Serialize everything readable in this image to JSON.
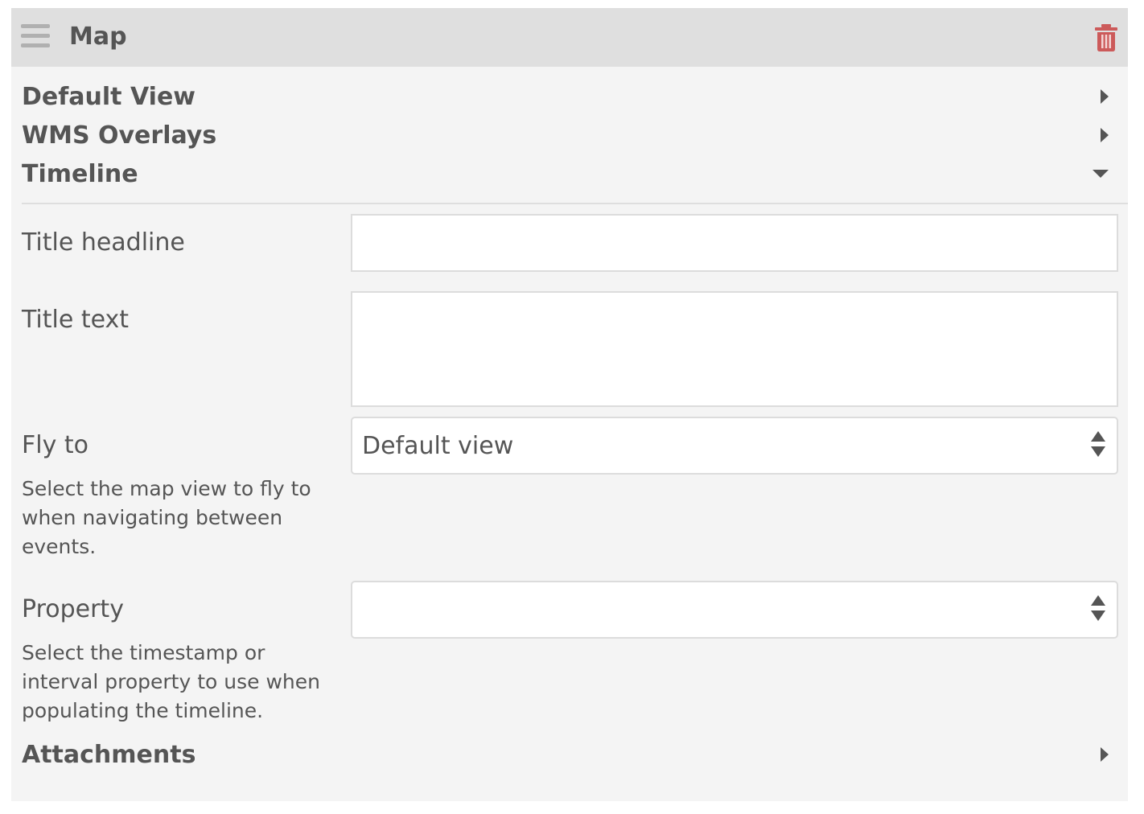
{
  "header": {
    "title": "Map",
    "menu_icon": "hamburger-icon",
    "delete_icon": "trash-icon",
    "delete_color": "#cc5a5a"
  },
  "sections": {
    "default_view": {
      "label": "Default View",
      "state": "collapsed"
    },
    "wms_overlays": {
      "label": "WMS Overlays",
      "state": "collapsed"
    },
    "timeline": {
      "label": "Timeline",
      "state": "expanded"
    },
    "attachments": {
      "label": "Attachments",
      "state": "collapsed"
    }
  },
  "timeline": {
    "title_headline": {
      "label": "Title headline",
      "value": ""
    },
    "title_text": {
      "label": "Title text",
      "value": ""
    },
    "fly_to": {
      "label": "Fly to",
      "selected": "Default view",
      "help": "Select the map view to fly to when navigating between events."
    },
    "property": {
      "label": "Property",
      "selected": "",
      "help": "Select the timestamp or interval property to use when populating the timeline."
    }
  }
}
